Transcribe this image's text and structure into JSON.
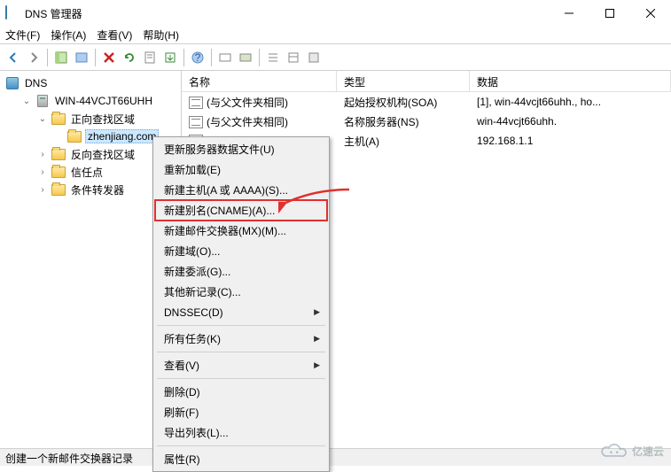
{
  "window": {
    "title": "DNS 管理器"
  },
  "menubar": {
    "file": "文件(F)",
    "action": "操作(A)",
    "view": "查看(V)",
    "help": "帮助(H)"
  },
  "tree": {
    "root": "DNS",
    "server": "WIN-44VCJT66UHH",
    "forward_zone": "正向查找区域",
    "zone_name": "zhenjiang.com",
    "reverse_zone": "反向查找区域",
    "trust_points": "信任点",
    "cond_forwarders": "条件转发器"
  },
  "list": {
    "header_name": "名称",
    "header_type": "类型",
    "header_data": "数据",
    "rows": [
      {
        "name": "(与父文件夹相同)",
        "type": "起始授权机构(SOA)",
        "data": "[1], win-44vcjt66uhh., ho..."
      },
      {
        "name": "(与父文件夹相同)",
        "type": "名称服务器(NS)",
        "data": "win-44vcjt66uhh."
      },
      {
        "name": "",
        "type": "主机(A)",
        "data": "192.168.1.1"
      }
    ]
  },
  "context": {
    "update_data": "更新服务器数据文件(U)",
    "reload": "重新加载(E)",
    "new_host": "新建主机(A 或 AAAA)(S)...",
    "new_cname": "新建别名(CNAME)(A)...",
    "new_mx": "新建邮件交换器(MX)(M)...",
    "new_domain": "新建域(O)...",
    "new_delegation": "新建委派(G)...",
    "other_new": "其他新记录(C)...",
    "dnssec": "DNSSEC(D)",
    "all_tasks": "所有任务(K)",
    "view": "查看(V)",
    "delete": "删除(D)",
    "refresh": "刷新(F)",
    "export_list": "导出列表(L)...",
    "properties": "属性(R)"
  },
  "status": "创建一个新邮件交换器记录",
  "watermark": "亿速云"
}
